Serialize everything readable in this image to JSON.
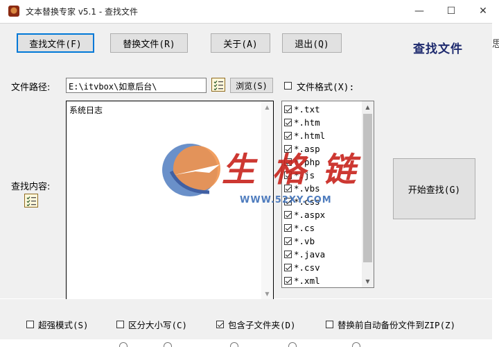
{
  "window": {
    "title": "文本替换专家 v5.1  -  查找文件",
    "min_glyph": "—",
    "max_glyph": "☐",
    "close_glyph": "✕"
  },
  "toolbar": {
    "find_files": "查找文件(F)",
    "replace_files": "替换文件(R)",
    "about": "关于(A)",
    "exit": "退出(Q)",
    "page_title": "查找文件",
    "edge_glyph": "思"
  },
  "main": {
    "file_path_label": "文件路径:",
    "file_path_value": "E:\\itvbox\\如意后台\\",
    "browse": "浏览(S)",
    "file_format_label": "文件格式(X):",
    "search_content_label": "查找内容:",
    "log_text": "系统日志",
    "start_search": "开始查找(G)",
    "formats": [
      {
        "ext": "*.txt",
        "checked": true
      },
      {
        "ext": "*.htm",
        "checked": true
      },
      {
        "ext": "*.html",
        "checked": true
      },
      {
        "ext": "*.asp",
        "checked": true
      },
      {
        "ext": "*.php",
        "checked": true
      },
      {
        "ext": "*.js",
        "checked": true
      },
      {
        "ext": "*.vbs",
        "checked": true
      },
      {
        "ext": "*.css",
        "checked": true
      },
      {
        "ext": "*.aspx",
        "checked": true
      },
      {
        "ext": "*.cs",
        "checked": true
      },
      {
        "ext": "*.vb",
        "checked": true
      },
      {
        "ext": "*.java",
        "checked": true
      },
      {
        "ext": "*.csv",
        "checked": true
      },
      {
        "ext": "*.xml",
        "checked": true
      }
    ]
  },
  "watermark": {
    "text": "生 格 链",
    "url": "WWW.52XY.COM"
  },
  "options": {
    "super_mode": "超强模式(S)",
    "case_sensitive": "区分大小写(C)",
    "include_subfolders": "包含子文件夹(D)",
    "backup_zip": "替换前自动备份文件到ZIP(Z)",
    "checked": {
      "super_mode": false,
      "case_sensitive": false,
      "include_subfolders": true,
      "backup_zip": false
    }
  },
  "colors": {
    "accent_border": "#0078d7",
    "panel_bg": "#f0f0f0",
    "title_navy": "#1e2a6e"
  }
}
